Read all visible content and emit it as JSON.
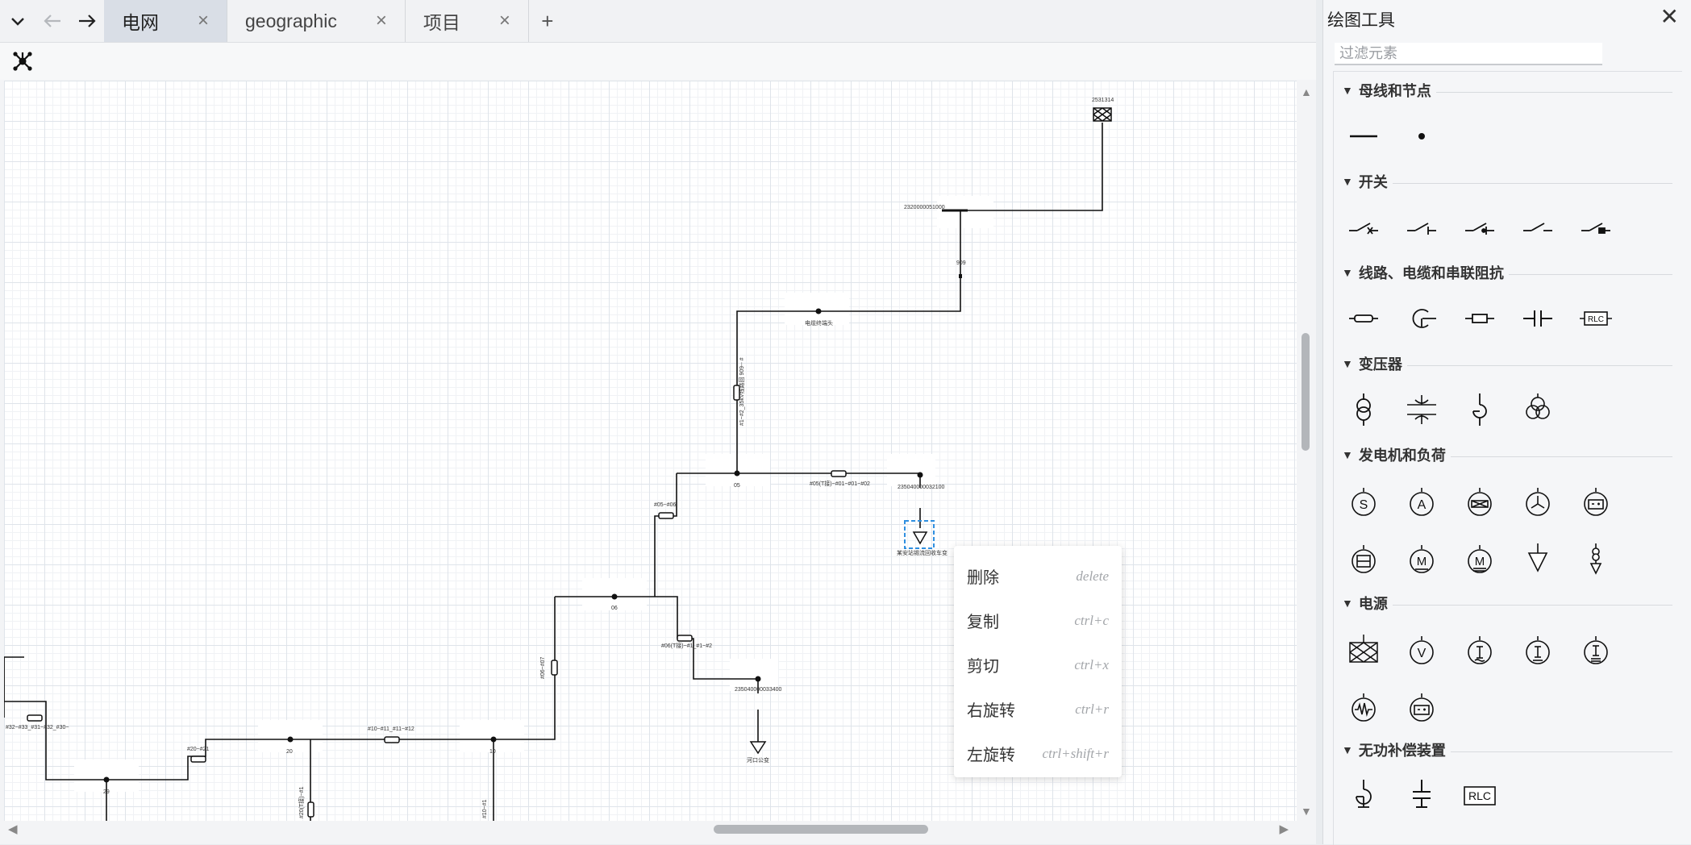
{
  "tabs": [
    {
      "label": "电网",
      "close": "×",
      "active": true
    },
    {
      "label": "geographic",
      "close": "×",
      "active": false
    },
    {
      "label": "项目",
      "close": "×",
      "active": false
    }
  ],
  "tabbar": {
    "add": "+"
  },
  "nav": {
    "back_disabled": true
  },
  "toolbar": {
    "network_icon": "network-icon"
  },
  "diagram": {
    "labels": {
      "top_node": "2531314",
      "breaker_node": "2320000051000",
      "n909": "909",
      "cable_end": "电缆终端头",
      "line_vertical": "#1~#2_35kV线路回 909-- #",
      "bus_05": "05",
      "line_05_01": "#05(T接)~#01~#01~#02",
      "node_235040": "235040000032100",
      "load_main": "某安站锡流回收车变",
      "line_05_06": "#05~#06",
      "bus_06": "06",
      "line_06t": "#06(T接)~#1_#1~#2",
      "node_2350400": "235040000033400",
      "load_river": "河口公变",
      "line_06_07": "#06~#07",
      "line_20_21": "#20~#21",
      "bus_20": "20",
      "line_10_12": "#10~#11_#11~#12",
      "bus_10": "10",
      "line_32": "#32~#33_#31~#32_#30~",
      "bus_29": "29",
      "branch_20": "#20(T接)~#1",
      "branch_10": "#10~#1"
    }
  },
  "context_menu": [
    {
      "label": "删除",
      "shortcut": "delete"
    },
    {
      "label": "复制",
      "shortcut": "ctrl+c"
    },
    {
      "label": "剪切",
      "shortcut": "ctrl+x"
    },
    {
      "label": "右旋转",
      "shortcut": "ctrl+r"
    },
    {
      "label": "左旋转",
      "shortcut": "ctrl+shift+r"
    }
  ],
  "panel": {
    "title": "绘图工具",
    "close": "✕",
    "filter_placeholder": "过滤元素",
    "sections": [
      {
        "title": "母线和节点",
        "tools": [
          "busbar-tool",
          "node-tool"
        ]
      },
      {
        "title": "开关",
        "tools": [
          "breaker-tool",
          "disconnector-tool",
          "load-switch-tool",
          "switch-tool",
          "grounding-switch-tool"
        ]
      },
      {
        "title": "线路、电缆和串联阻抗",
        "tools": [
          "line-tool",
          "cable-tool",
          "series-impedance-tool",
          "series-capacitor-tool",
          "rlc-tool"
        ]
      },
      {
        "title": "变压器",
        "tools": [
          "two-winding-transformer-tool",
          "phase-shifter-tool",
          "reactor-transformer-tool",
          "three-winding-transformer-tool"
        ]
      },
      {
        "title": "发电机和负荷",
        "tools": [
          "synchronous-generator-tool",
          "asynchronous-generator-tool",
          "pv-generator-tool",
          "wind-generator-tool",
          "battery-generator-tool",
          "static-generator-tool",
          "motor-tool",
          "motor-load-tool",
          "load-tool",
          "general-load-tool"
        ]
      },
      {
        "title": "电源",
        "tools": [
          "external-grid-tool",
          "voltage-source-tool",
          "current-source-tool",
          "dc-current-source-tool",
          "ac-current-source-tool",
          "ac-source-tool",
          "battery-source-tool"
        ]
      },
      {
        "title": "无功补偿装置",
        "tools": [
          "shunt-reactor-tool",
          "shunt-capacitor-tool",
          "shunt-rlc-tool"
        ]
      }
    ],
    "icon_text": {
      "rlc": "RLC",
      "s": "S",
      "a": "A",
      "m": "M",
      "v": "V"
    }
  },
  "colors": {
    "selection": "#2f8fe0",
    "tab_active": "#d9dee6",
    "line": "#111111"
  }
}
